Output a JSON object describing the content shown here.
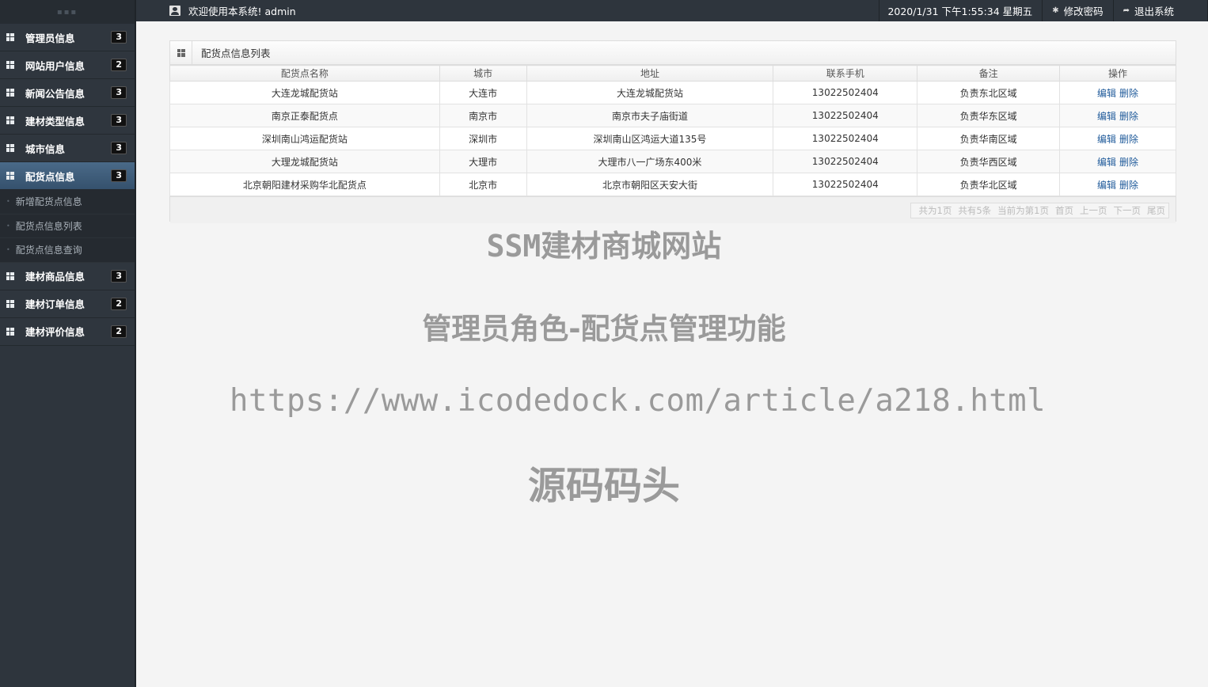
{
  "header": {
    "welcome": "欢迎使用本系统! admin",
    "datetime": "2020/1/31 下午1:55:34 星期五",
    "change_password": "修改密码",
    "logout": "退出系统"
  },
  "sidebar": {
    "items": [
      {
        "label": "管理员信息",
        "badge": "3"
      },
      {
        "label": "网站用户信息",
        "badge": "2"
      },
      {
        "label": "新闻公告信息",
        "badge": "3"
      },
      {
        "label": "建材类型信息",
        "badge": "3"
      },
      {
        "label": "城市信息",
        "badge": "3"
      },
      {
        "label": "配货点信息",
        "badge": "3"
      },
      {
        "label": "建材商品信息",
        "badge": "3"
      },
      {
        "label": "建材订单信息",
        "badge": "2"
      },
      {
        "label": "建材评价信息",
        "badge": "2"
      }
    ],
    "subitems": [
      "新增配货点信息",
      "配货点信息列表",
      "配货点信息查询"
    ]
  },
  "panel": {
    "title": "配货点信息列表",
    "columns": [
      "配货点名称",
      "城市",
      "地址",
      "联系手机",
      "备注",
      "操作"
    ],
    "rows": [
      {
        "name": "大连龙城配货站",
        "city": "大连市",
        "address": "大连龙城配货站",
        "phone": "13022502404",
        "note": "负责东北区域"
      },
      {
        "name": "南京正泰配货点",
        "city": "南京市",
        "address": "南京市夫子庙街道",
        "phone": "13022502404",
        "note": "负责华东区域"
      },
      {
        "name": "深圳南山鸿运配货站",
        "city": "深圳市",
        "address": "深圳南山区鸿运大道135号",
        "phone": "13022502404",
        "note": "负责华南区域"
      },
      {
        "name": "大理龙城配货站",
        "city": "大理市",
        "address": "大理市八一广场东400米",
        "phone": "13022502404",
        "note": "负责华西区域"
      },
      {
        "name": "北京朝阳建材采购华北配货点",
        "city": "北京市",
        "address": "北京市朝阳区天安大街",
        "phone": "13022502404",
        "note": "负责华北区域"
      }
    ],
    "edit_label": "编辑",
    "delete_label": "删除",
    "pager": {
      "total_pages": "共为1页",
      "total_items": "共有5条",
      "current": "当前为第1页",
      "first": "首页",
      "prev": "上一页",
      "next": "下一页",
      "last": "尾页"
    }
  },
  "watermark": {
    "line1": "SSM建材商城网站",
    "line2": "管理员角色-配货点管理功能",
    "line3": "https://www.icodedock.com/article/a218.html",
    "line4": "源码码头"
  }
}
